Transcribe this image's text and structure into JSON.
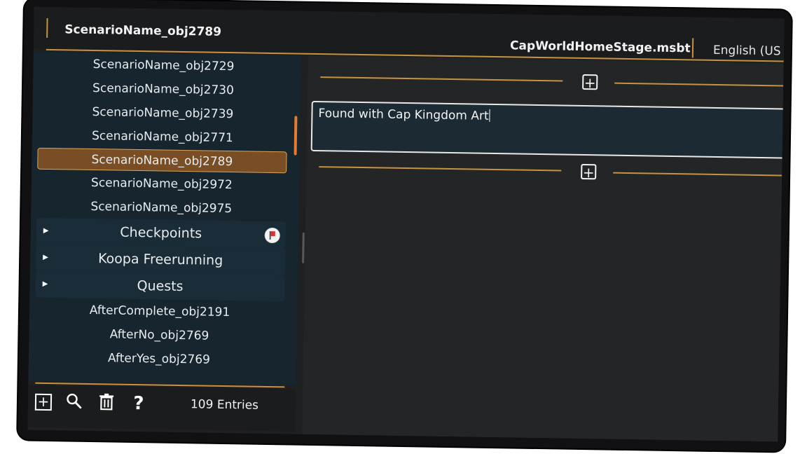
{
  "header": {
    "title": "ScenarioName_obj2789",
    "file_name": "CapWorldHomeStage.msbt",
    "language": "English (US"
  },
  "list": {
    "items": [
      {
        "label": "ScenarioName_obj2729"
      },
      {
        "label": "ScenarioName_obj2730"
      },
      {
        "label": "ScenarioName_obj2739"
      },
      {
        "label": "ScenarioName_obj2771"
      },
      {
        "label": "ScenarioName_obj2789",
        "selected": true
      },
      {
        "label": "ScenarioName_obj2972"
      },
      {
        "label": "ScenarioName_obj2975"
      }
    ],
    "categories": [
      {
        "label": "Checkpoints",
        "icon": "flag-icon"
      },
      {
        "label": "Koopa Freerunning"
      },
      {
        "label": "Quests"
      }
    ],
    "items_after": [
      {
        "label": "AfterComplete_obj2191"
      },
      {
        "label": "AfterNo_obj2769"
      },
      {
        "label": "AfterYes_obj2769"
      }
    ]
  },
  "footer": {
    "icons": [
      "add-icon",
      "search-icon",
      "trash-icon",
      "help-icon"
    ],
    "help_glyph": "?",
    "entry_count": "109 Entries"
  },
  "editor": {
    "text_value": "Found with Cap Kingdom Art"
  },
  "colors": {
    "accent": "#c8923f",
    "selected_bg": "#7a4e25",
    "scroll_thumb": "#e77a2e",
    "list_bg": "#17252f"
  }
}
